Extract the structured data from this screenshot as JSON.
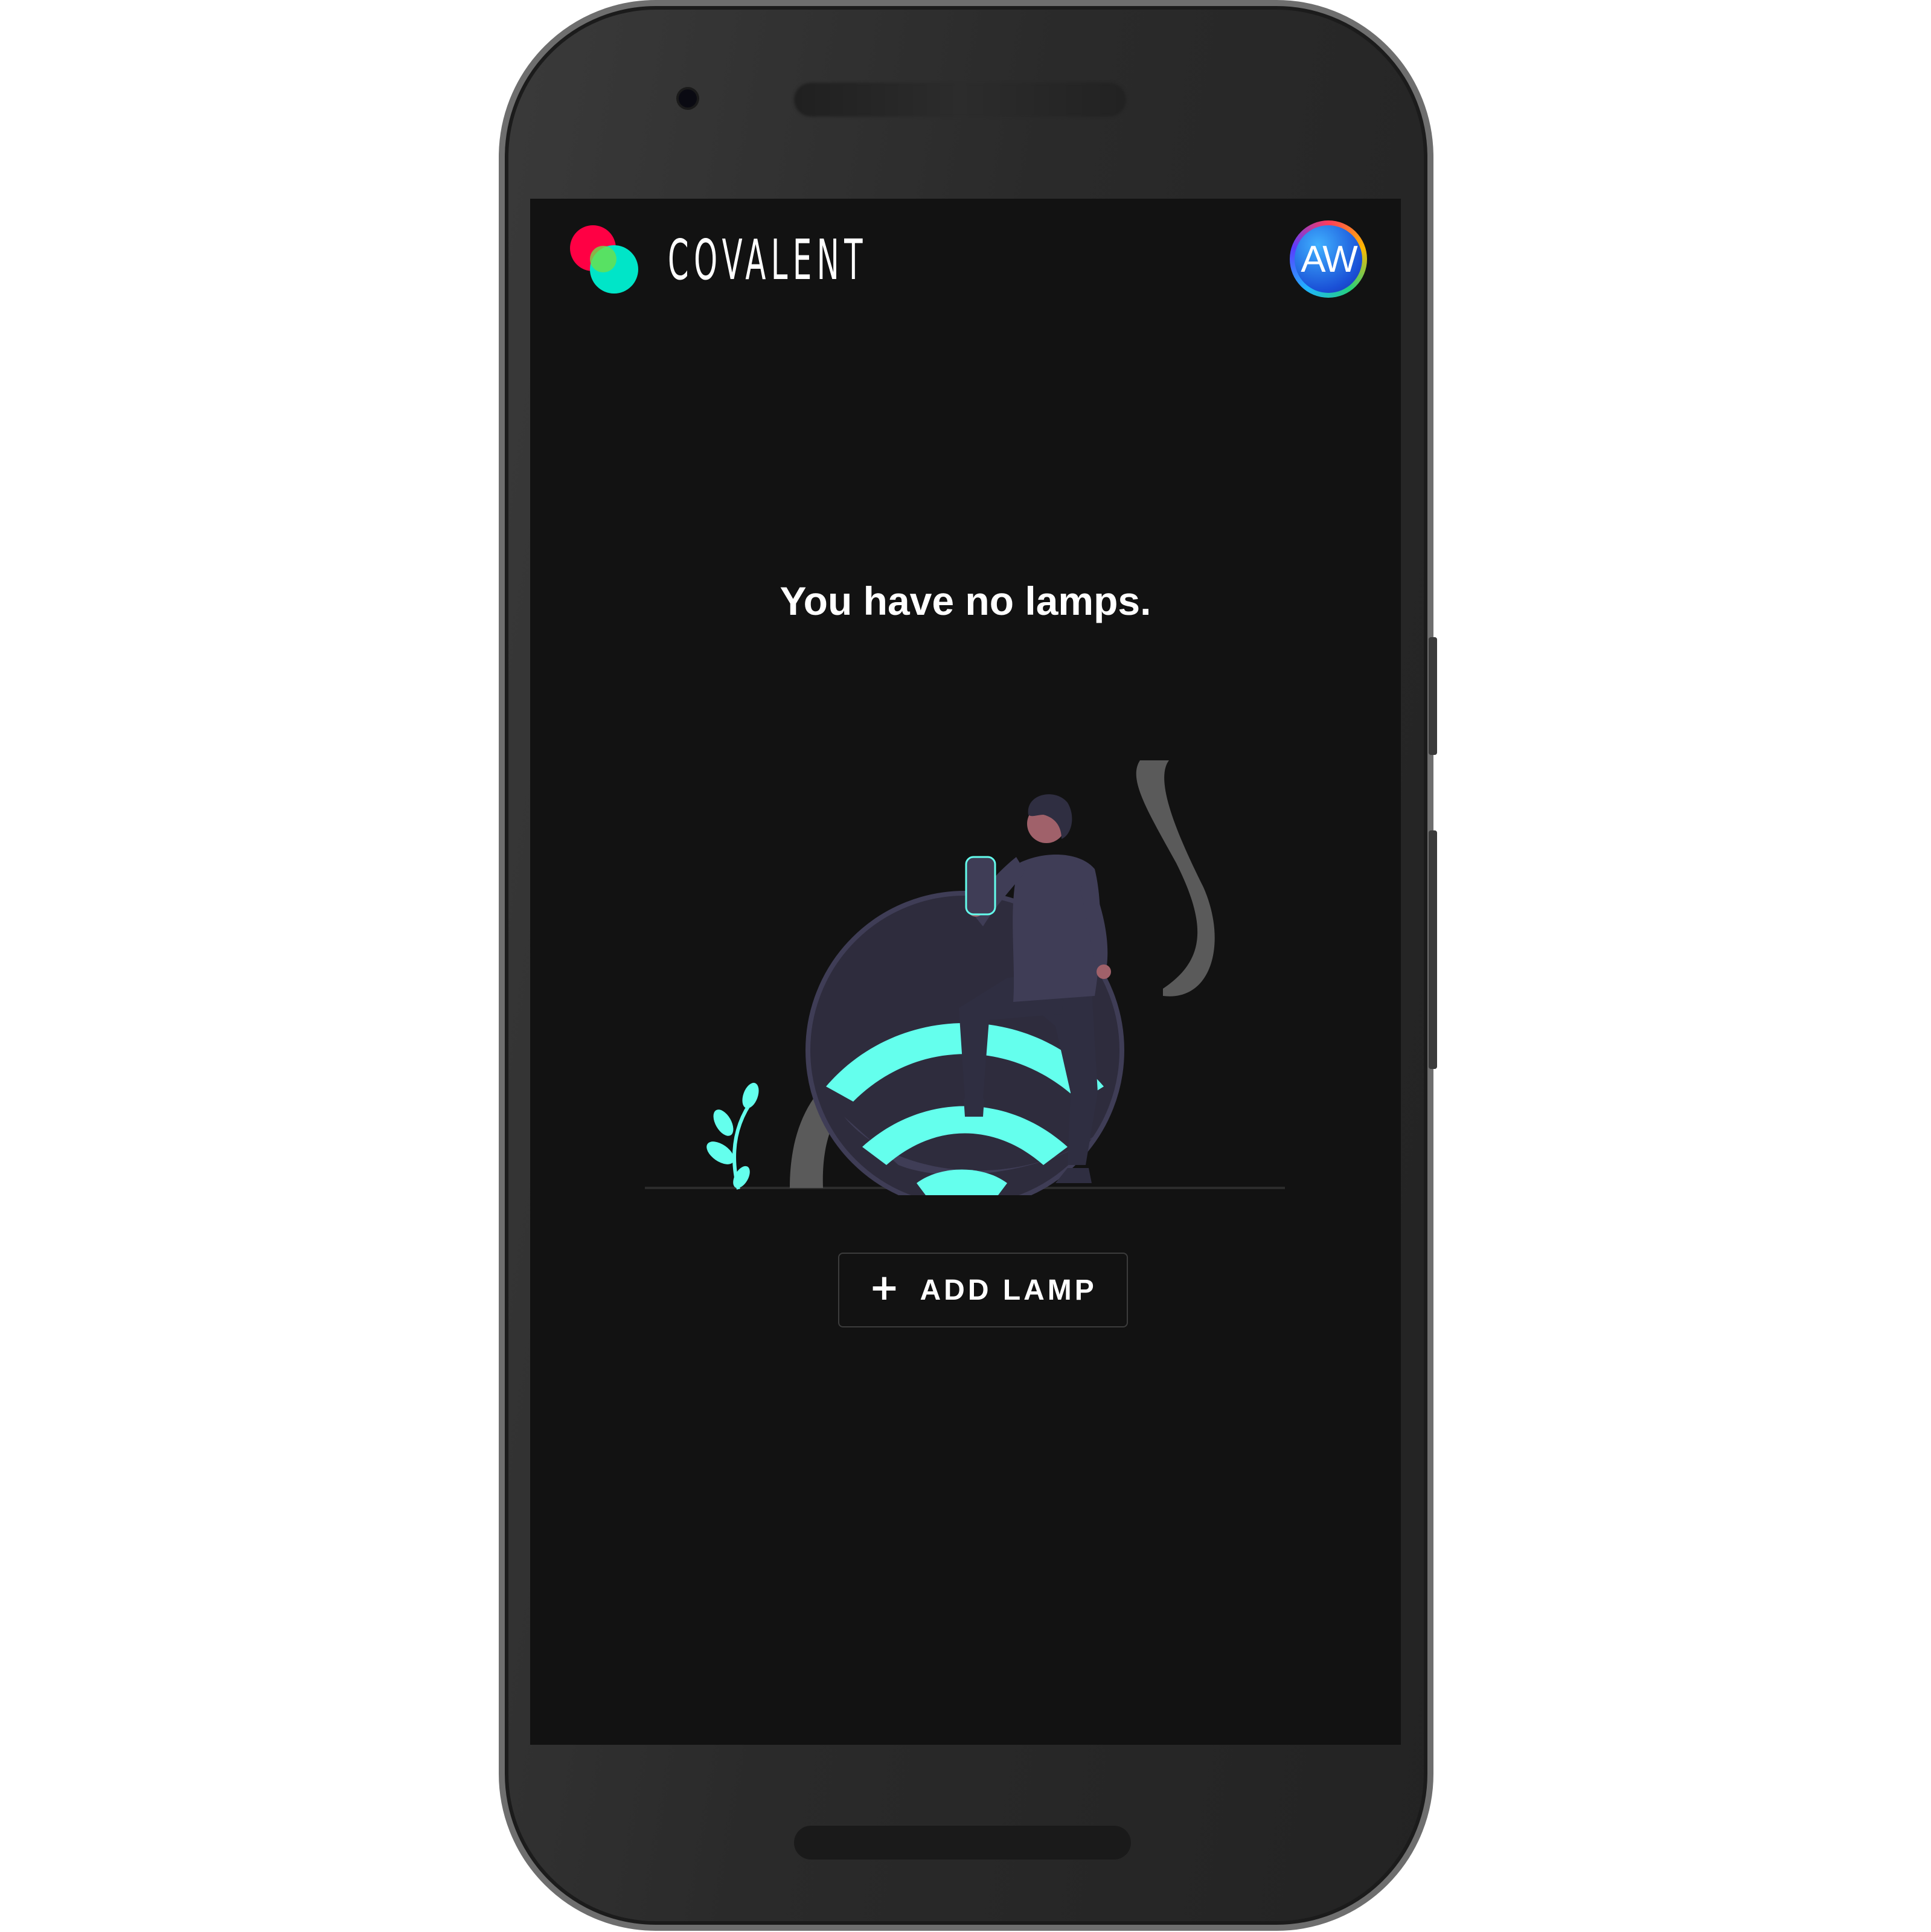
{
  "app": {
    "brand": "COVALENT",
    "avatar_initials": "AW"
  },
  "main": {
    "empty_message": "You have no lamps.",
    "add_button_label": "ADD LAMP",
    "add_button_icon": "plus-icon"
  },
  "colors": {
    "screen_background": "#121212",
    "accent": "#64ffed",
    "logo_red": "#ff0044",
    "logo_teal": "#00e5c8",
    "illustration_dark": "#3f3d56"
  }
}
